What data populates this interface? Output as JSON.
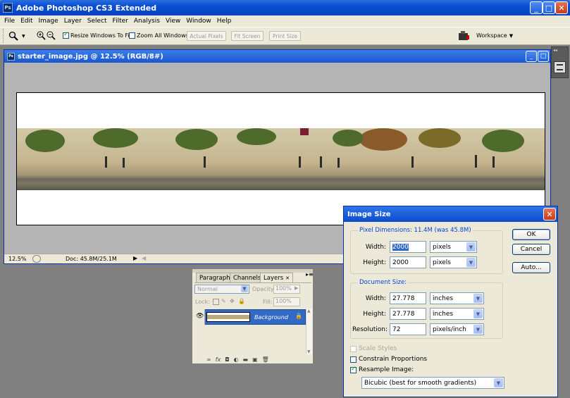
{
  "app": {
    "title": "Adobe Photoshop CS3 Extended",
    "title_icon": "Ps"
  },
  "menu": [
    "File",
    "Edit",
    "Image",
    "Layer",
    "Select",
    "Filter",
    "Analysis",
    "View",
    "Window",
    "Help"
  ],
  "options": {
    "resize_windows_label": "Resize Windows To Fit",
    "resize_windows_checked": true,
    "zoom_all_label": "Zoom All Windows",
    "zoom_all_checked": false,
    "actual_pixels": "Actual Pixels",
    "fit_screen": "Fit Screen",
    "print_size": "Print Size",
    "workspace": "Workspace"
  },
  "document": {
    "title": "starter_image.jpg @ 12.5% (RGB/8#)",
    "title_icon": "Ps",
    "zoom": "12.5%",
    "doc_info": "Doc: 45.8M/25.1M"
  },
  "layers_panel": {
    "tabs": [
      "Paragraph",
      "Channels",
      "Layers"
    ],
    "active_tab": "Layers",
    "blend_mode": "Normal",
    "opacity_label": "Opacity:",
    "opacity_value": "100%",
    "lock_label": "Lock:",
    "fill_label": "Fill:",
    "fill_value": "100%",
    "layer_name": "Background"
  },
  "dialog": {
    "title": "Image Size",
    "pixel_dimensions_label": "Pixel Dimensions:  11.4M (was 45.8M)",
    "px_width_label": "Width:",
    "px_width_value": "2000",
    "px_width_unit": "pixels",
    "px_height_label": "Height:",
    "px_height_value": "2000",
    "px_height_unit": "pixels",
    "document_size_label": "Document Size:",
    "doc_width_label": "Width:",
    "doc_width_value": "27.778",
    "doc_width_unit": "inches",
    "doc_height_label": "Height:",
    "doc_height_value": "27.778",
    "doc_height_unit": "inches",
    "resolution_label": "Resolution:",
    "resolution_value": "72",
    "resolution_unit": "pixels/inch",
    "scale_styles_label": "Scale Styles",
    "scale_styles_checked": false,
    "constrain_label": "Constrain Proportions",
    "constrain_checked": false,
    "resample_label": "Resample Image:",
    "resample_checked": true,
    "resample_method": "Bicubic (best for smooth gradients)",
    "ok": "OK",
    "cancel": "Cancel",
    "auto": "Auto..."
  },
  "colors": {
    "xp_blue": "#0a4cd2",
    "dialog_group_title": "#0046d5",
    "canvas_bg": "#808080"
  }
}
